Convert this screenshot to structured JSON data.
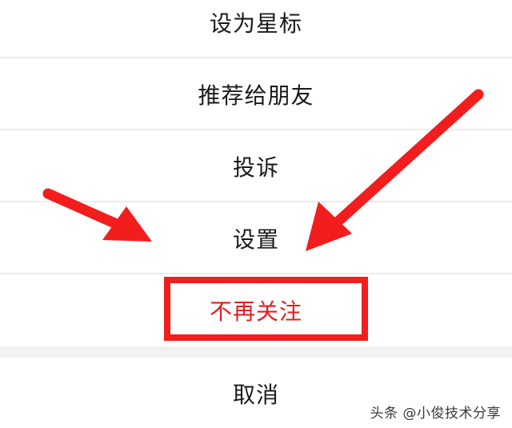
{
  "menu": {
    "items": [
      {
        "label": "设为星标"
      },
      {
        "label": "推荐给朋友"
      },
      {
        "label": "投诉"
      },
      {
        "label": "设置"
      },
      {
        "label": "不再关注"
      }
    ],
    "cancel_label": "取消"
  },
  "annotation": {
    "highlight_color": "#f21d1d",
    "arrow_color": "#f21d1d"
  },
  "watermark": {
    "text": "头条 @小俊技术分享"
  }
}
